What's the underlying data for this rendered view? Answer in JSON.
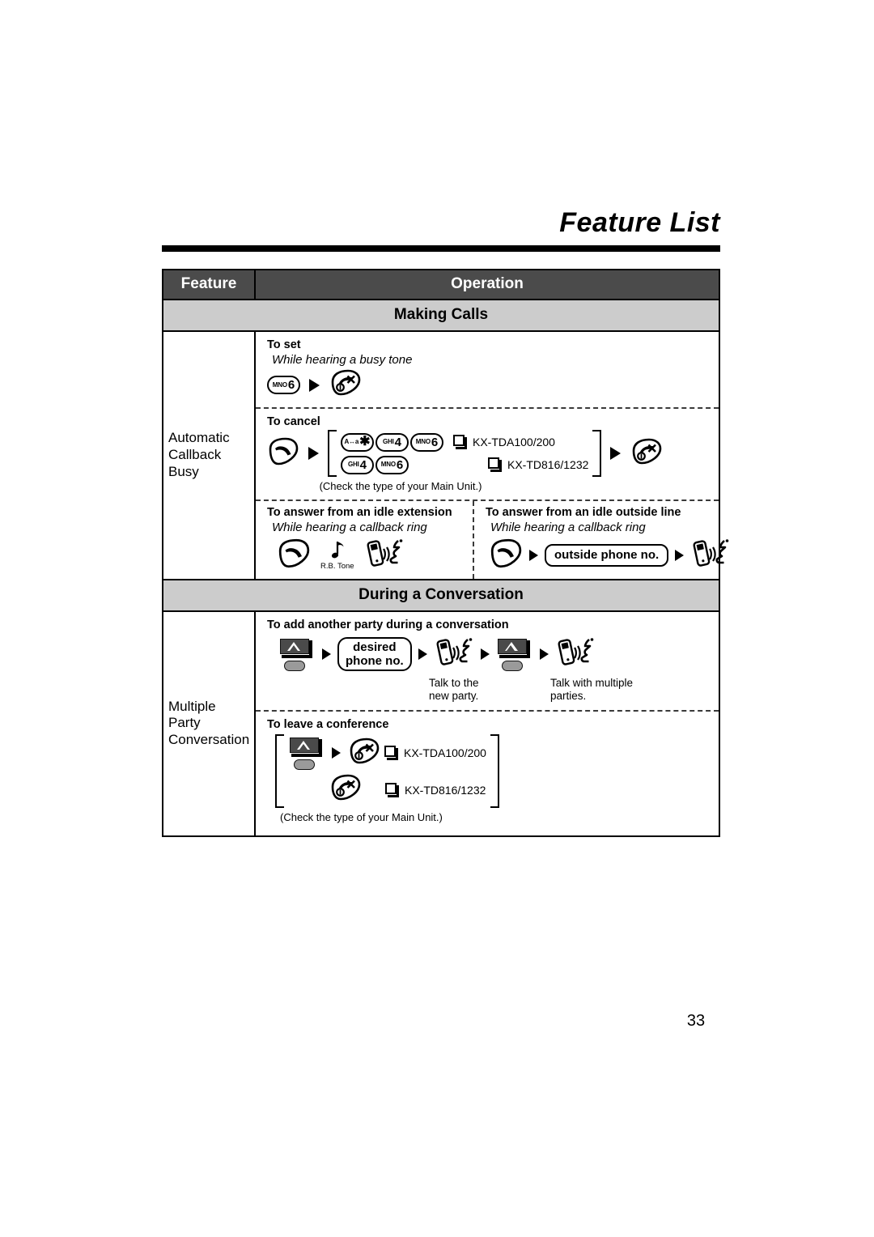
{
  "document": {
    "title": "Feature List",
    "page_number": "33"
  },
  "table": {
    "headers": {
      "feature": "Feature",
      "operation": "Operation"
    },
    "sections": [
      {
        "section_title": "Making Calls",
        "feature": "Automatic Callback Busy",
        "feature_lines": [
          "Automatic",
          "Callback",
          "Busy"
        ],
        "blocks": [
          {
            "heading": "To set",
            "condition": "While hearing a busy tone",
            "steps": [
              {
                "type": "key",
                "prefix": "MNO",
                "digit": "6"
              },
              {
                "type": "arrow"
              },
              {
                "type": "icon",
                "icon": "hang-up-icon"
              }
            ]
          },
          {
            "heading": "To cancel",
            "steps": [
              {
                "type": "icon",
                "icon": "off-hook-icon"
              },
              {
                "type": "arrow"
              },
              {
                "type": "bracket"
              },
              {
                "type": "arrow"
              },
              {
                "type": "icon",
                "icon": "hang-up-icon"
              }
            ],
            "bracket_rows": [
              {
                "keys": [
                  {
                    "prefix": "A↔a",
                    "digit": "✱"
                  },
                  {
                    "prefix": "GHI",
                    "digit": "4"
                  },
                  {
                    "prefix": "MNO",
                    "digit": "6"
                  }
                ],
                "model": "KX-TDA100/200"
              },
              {
                "keys": [
                  {
                    "prefix": "GHI",
                    "digit": "4"
                  },
                  {
                    "prefix": "MNO",
                    "digit": "6"
                  }
                ],
                "model": "KX-TD816/1232"
              }
            ],
            "note": "(Check the type of your Main Unit.)"
          },
          {
            "split": true,
            "left": {
              "heading": "To answer from an idle extension",
              "condition": "While hearing a callback ring",
              "tone_label": "R.B. Tone",
              "steps": [
                {
                  "type": "icon",
                  "icon": "off-hook-icon"
                },
                {
                  "type": "icon",
                  "icon": "ringback-tone-icon"
                },
                {
                  "type": "icon",
                  "icon": "talking-icon"
                }
              ]
            },
            "right": {
              "heading": "To answer from an idle outside line",
              "condition": "While hearing a callback ring",
              "steps": [
                {
                  "type": "icon",
                  "icon": "off-hook-icon"
                },
                {
                  "type": "arrow"
                },
                {
                  "type": "box",
                  "label": "outside phone no."
                },
                {
                  "type": "arrow"
                },
                {
                  "type": "icon",
                  "icon": "talking-icon"
                }
              ]
            }
          }
        ]
      },
      {
        "section_title": "During a Conversation",
        "feature": "Multiple Party Conversation",
        "feature_lines": [
          "Multiple",
          "Party",
          "Conversation"
        ],
        "blocks": [
          {
            "heading": "To add another party during a conversation",
            "steps": [
              {
                "type": "icon",
                "icon": "conference-key-icon"
              },
              {
                "type": "arrow"
              },
              {
                "type": "box",
                "label_line1": "desired",
                "label_line2": "phone no."
              },
              {
                "type": "arrow"
              },
              {
                "type": "icon",
                "icon": "talking-icon",
                "caption": "Talk to the new party."
              },
              {
                "type": "arrow"
              },
              {
                "type": "icon",
                "icon": "conference-key-icon"
              },
              {
                "type": "arrow"
              },
              {
                "type": "icon",
                "icon": "talking-icon",
                "caption": "Talk with multiple parties."
              }
            ],
            "caption_1_line1": "Talk to the",
            "caption_1_line2": "new party.",
            "caption_2_line1": "Talk with multiple",
            "caption_2_line2": "parties."
          },
          {
            "heading": "To leave a conference",
            "bracket_rows": [
              {
                "model": "KX-TDA100/200"
              },
              {
                "model": "KX-TD816/1232"
              }
            ],
            "note": "(Check the type of your Main Unit.)"
          }
        ]
      }
    ]
  },
  "colors": {
    "header_bg": "#4b4b4b",
    "section_bg": "#cccccc",
    "border": "#000000",
    "text": "#000000"
  }
}
